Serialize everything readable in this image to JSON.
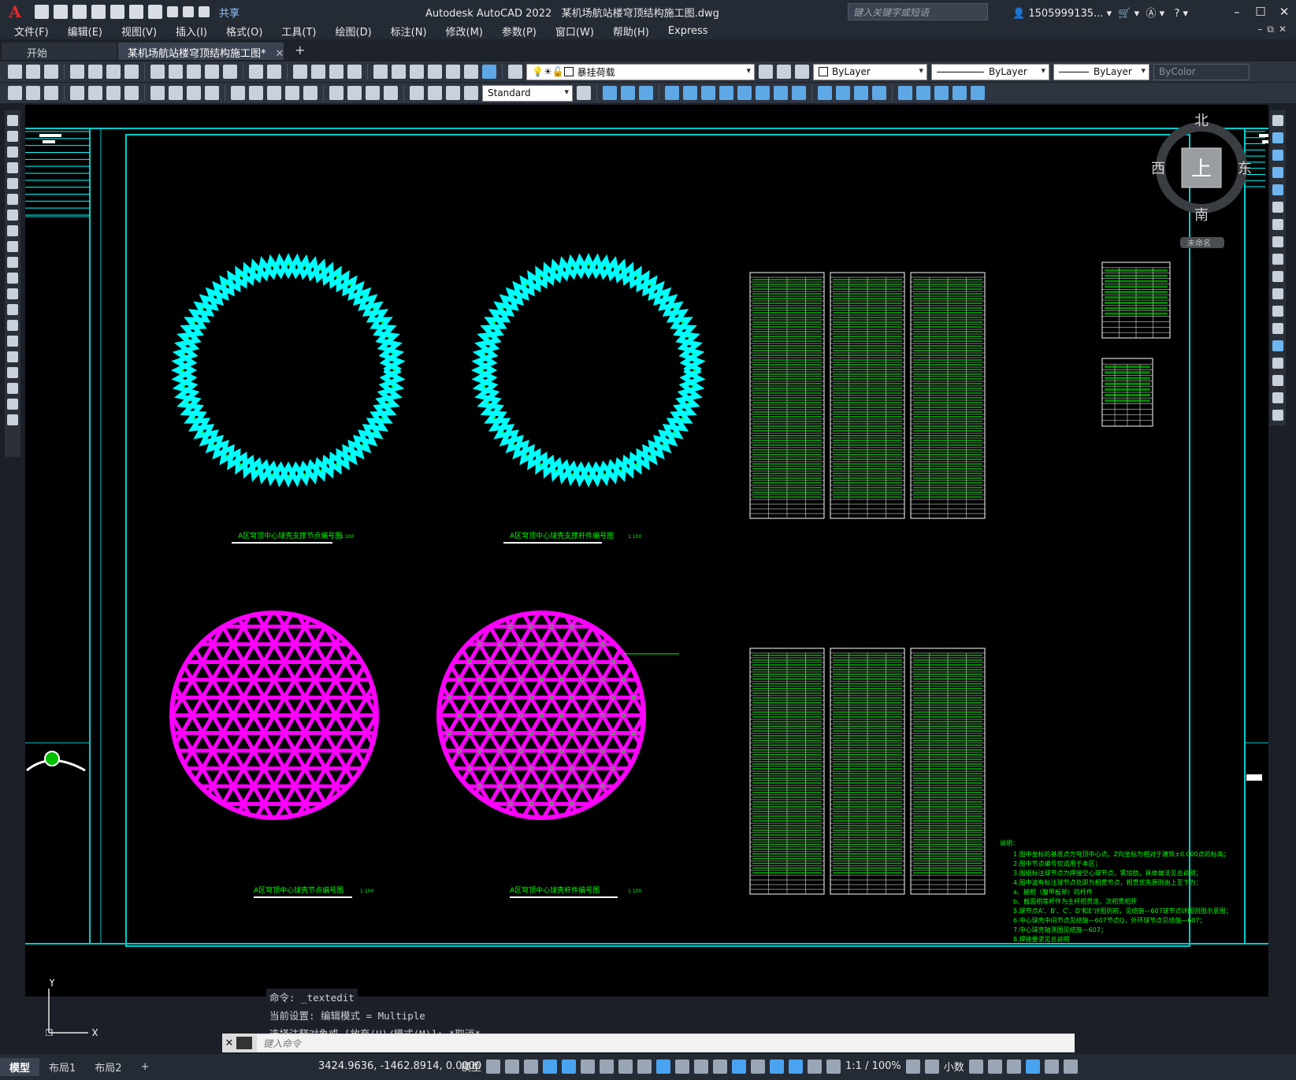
{
  "app": {
    "title": "Autodesk AutoCAD 2022",
    "document": "某机场航站楼穹顶结构施工图.dwg",
    "share_label": "共享",
    "search_placeholder": "键入关键字或短语",
    "user": "1505999135...",
    "window_controls": [
      "–",
      "☐",
      "✕"
    ]
  },
  "menu": [
    "文件(F)",
    "编辑(E)",
    "视图(V)",
    "插入(I)",
    "格式(O)",
    "工具(T)",
    "绘图(D)",
    "标注(N)",
    "修改(M)",
    "参数(P)",
    "窗口(W)",
    "帮助(H)",
    "Express"
  ],
  "tabs": {
    "start": "开始",
    "active": "某机场航站楼穹顶结构施工图*",
    "close": "✕",
    "add": "+"
  },
  "toolbar": {
    "layer_current": "暴挂荷载",
    "color": "ByLayer",
    "linetype": "ByLayer",
    "lineweight": "ByLayer",
    "plotstyle": "ByColor",
    "text_style": "Standard"
  },
  "viewcube": {
    "north": "北",
    "south": "南",
    "east": "东",
    "west": "西",
    "top": "上",
    "wcs": "未命名"
  },
  "drawing": {
    "caption1": "A区穹顶中心球壳支撑节点编号图",
    "caption2": "A区穹顶中心球壳支撑杆件编号图",
    "caption3": "A区穹顶中心球壳节点编号图",
    "caption4": "A区穹顶中心球壳杆件编号图",
    "scale_note": "1:100",
    "notes_title": "说明：",
    "notes": [
      "1.图中坐标的基准点为穹顶中心点，Z向坐标为相对于建筑±0.000点的标高；",
      "2.图中节点编号仅适用于本区；",
      "3.图纸标注球节点为焊接空心球节点，需加肋，具体做法见总说明；",
      "4.图中波有标注球节点处即为相贯节点，相贯优先原则由上至下为：",
      "   a、被相（腹甲板单）的杆件",
      "   b、截面相等杆件为主杆相贯连，次相贯相开",
      "5.球节点A'、B'、C'、D'和E'详图则前，见结施—607球节点详图则图示意图；",
      "6.中心球壳中间节点见结施—607节点Q，外环球节点见结施—607；",
      "7.中心球壳轴测图见结施—607；",
      "8.焊接要求见总说明"
    ]
  },
  "command": {
    "history": [
      "命令: _textedit",
      "当前设置: 编辑模式 = Multiple",
      "选择注释对象或 [放弃(U)/模式(M)]: *取消*"
    ],
    "placeholder": "键入命令"
  },
  "ucs": {
    "x_label": "X",
    "y_label": "Y"
  },
  "status": {
    "layouts": [
      "模型",
      "布局1",
      "布局2"
    ],
    "add_layout": "+",
    "coords": "3424.9636, -1462.8914, 0.0000",
    "space": "模型",
    "scale": "1:1 / 100%",
    "units": "小数"
  },
  "colors": {
    "cyan": "#00ffff",
    "magenta": "#ff00ff",
    "green": "#00ff00",
    "frame": "#00cccc"
  }
}
